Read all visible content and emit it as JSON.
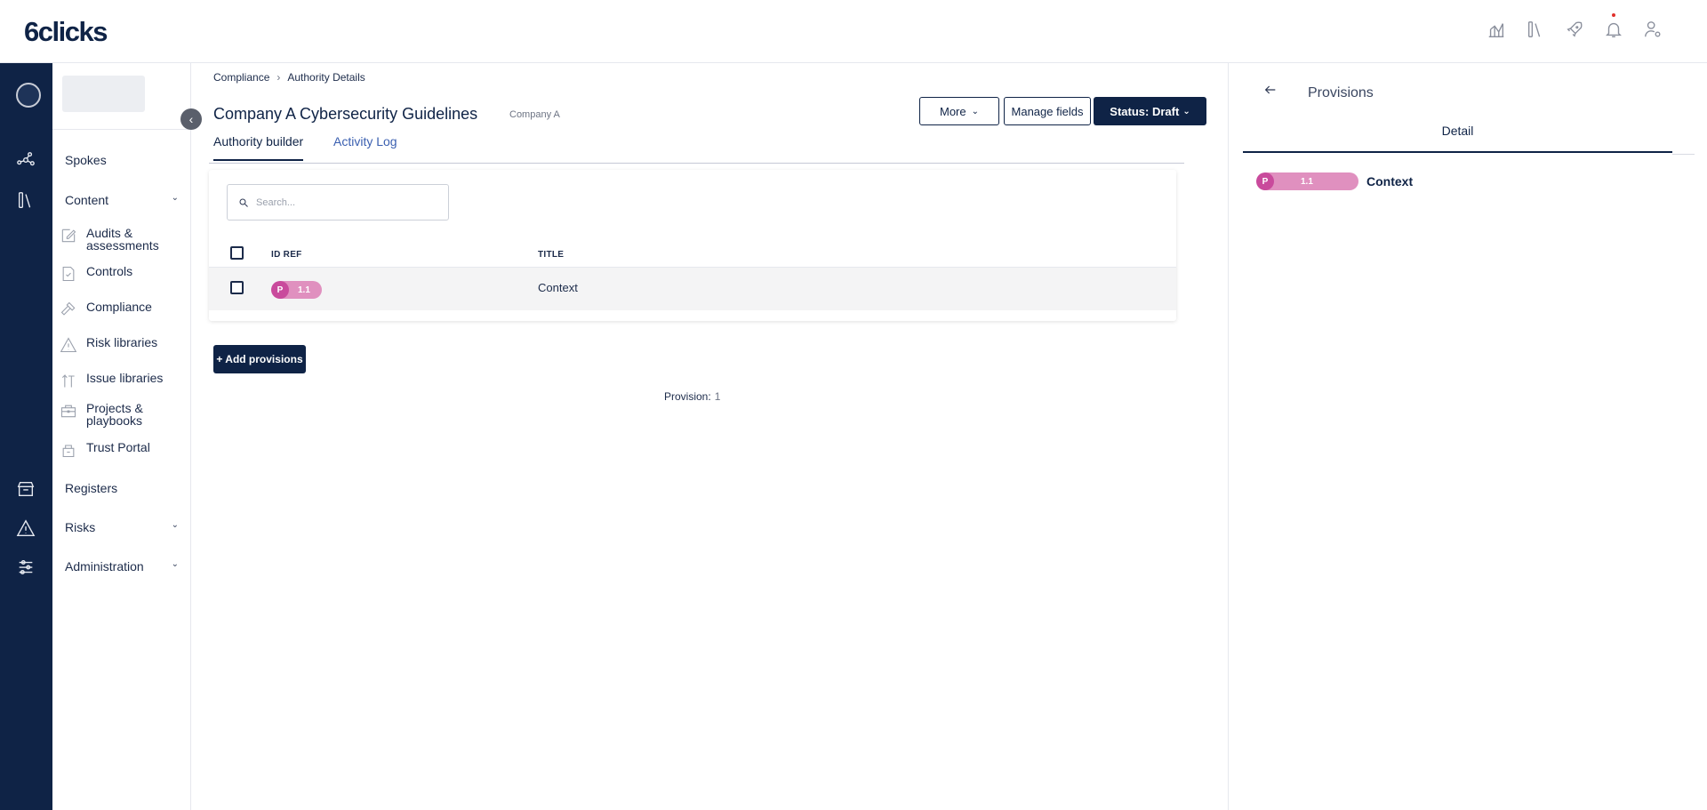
{
  "app": {
    "logo": "6clicks"
  },
  "topbar": {
    "icons": [
      "analytics-icon",
      "library-icon",
      "rocket-icon",
      "bell-icon",
      "user-settings-icon"
    ]
  },
  "rail": {
    "icons": [
      "spokes-icon",
      "library-icon",
      "registers-icon",
      "risks-icon",
      "administration-icon"
    ]
  },
  "sidebar": {
    "top_items": {
      "spokes": "Spokes",
      "content": "Content",
      "registers": "Registers",
      "risks": "Risks",
      "administration": "Administration"
    },
    "content_items": [
      {
        "label": "Audits & assessments",
        "icon": "edit-icon"
      },
      {
        "label": "Controls",
        "icon": "document-check-icon"
      },
      {
        "label": "Compliance",
        "icon": "gavel-icon"
      },
      {
        "label": "Risk libraries",
        "icon": "warning-icon"
      },
      {
        "label": "Issue libraries",
        "icon": "issue-icon"
      },
      {
        "label": "Projects & playbooks",
        "icon": "briefcase-icon"
      },
      {
        "label": "Trust Portal",
        "icon": "trust-portal-icon"
      }
    ]
  },
  "breadcrumb": {
    "parent": "Compliance",
    "current": "Authority Details"
  },
  "header": {
    "title": "Company A Cybersecurity Guidelines",
    "subtitle": "Company A",
    "more_label": "More",
    "manage_fields_label": "Manage fields",
    "status_label": "Status: Draft"
  },
  "tabs": {
    "authority_builder": "Authority builder",
    "activity_log": "Activity Log"
  },
  "table": {
    "search_placeholder": "Search...",
    "columns": {
      "id_ref": "ID REF",
      "title": "TITLE"
    },
    "rows": [
      {
        "badge": "P",
        "id": "1.1",
        "title": "Context"
      }
    ]
  },
  "actions": {
    "add_provisions": "+ Add provisions"
  },
  "footer": {
    "count_label": "Provision:",
    "count_value": "1"
  },
  "right_panel": {
    "title": "Provisions",
    "tab": "Detail",
    "item": {
      "badge": "P",
      "id": "1.1",
      "title": "Context"
    }
  },
  "colors": {
    "navy": "#0f2346",
    "pill": "#e090bf",
    "pill_badge": "#c94a9c",
    "link": "#3a5fb0"
  }
}
